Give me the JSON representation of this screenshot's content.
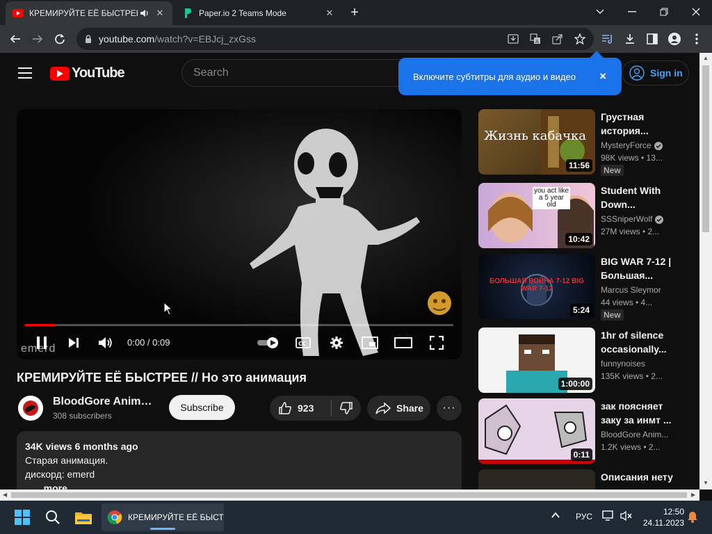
{
  "browser": {
    "tabs": [
      {
        "title": "КРЕМИРУЙТЕ ЕЁ БЫСТРЕЕ /",
        "active": true
      },
      {
        "title": "Paper.io 2 Teams Mode",
        "active": false
      }
    ],
    "url_host": "youtube.com",
    "url_path": "/watch?v=EBJcj_zxGss"
  },
  "youtube": {
    "logo_text": "YouTube",
    "search_placeholder": "Search",
    "signin_label": "Sign in",
    "toast_text": "Включите субтитры для аудио и видео",
    "toast_close": "×"
  },
  "player": {
    "timecode": "0:00 / 0:09",
    "watermark": "emerd",
    "progress_fraction": 0.07
  },
  "video": {
    "title": "КРЕМИРУЙТЕ ЕЁ БЫСТРЕЕ // Но это анимация",
    "channel": "BloodGore Animat...",
    "subscribers": "308 subscribers",
    "subscribe_label": "Subscribe",
    "likes": "923",
    "share_label": "Share",
    "more_label": "···",
    "desc_stats": "34K views  6 months ago",
    "desc_line1": "Старая анимация.",
    "desc_line2": "дискорд: emerd",
    "desc_more": "...more"
  },
  "recommendations": [
    {
      "title": "Грустная история...",
      "channel": "MysteryForce",
      "verified": true,
      "meta": "98K views • 13...",
      "duration": "11:56",
      "badge": "New",
      "thumb_text": "Жизнь кабачка"
    },
    {
      "title": "Student With Down...",
      "channel": "SSSniperWolf",
      "verified": true,
      "meta": "27M views • 2...",
      "duration": "10:42",
      "badge": "",
      "thumb_text": "you act like a 5 year old"
    },
    {
      "title": "BIG WAR 7-12 | Большая...",
      "channel": "Marcus Sleymor",
      "verified": false,
      "meta": "44 views • 4...",
      "duration": "5:24",
      "badge": "New",
      "thumb_text": "БОЛЬШАЯ ВОЙНА 7-12 BIG WAR 7-12"
    },
    {
      "title": "1hr of silence occasionally...",
      "channel": "funnynoises",
      "verified": false,
      "meta": "135K views • 2...",
      "duration": "1:00:00",
      "badge": "",
      "thumb_text": ""
    },
    {
      "title": "зак поясняет заку за инмт ...",
      "channel": "BloodGore Anim...",
      "verified": false,
      "meta": "1.2K views • 2...",
      "duration": "0:11",
      "badge": "",
      "thumb_text": ""
    },
    {
      "title": "Описания нету",
      "channel": "",
      "verified": false,
      "meta": "",
      "duration": "",
      "badge": "",
      "thumb_text": ""
    }
  ],
  "taskbar": {
    "chrome_label": "КРЕМИРУЙТЕ ЕЁ БЫСТР",
    "lang": "РУС",
    "time": "12:50",
    "date": "24.11.2023"
  },
  "colors": {
    "yt_red": "#ff0000",
    "toast_blue": "#1a73e8",
    "link_blue": "#3ea6ff"
  }
}
